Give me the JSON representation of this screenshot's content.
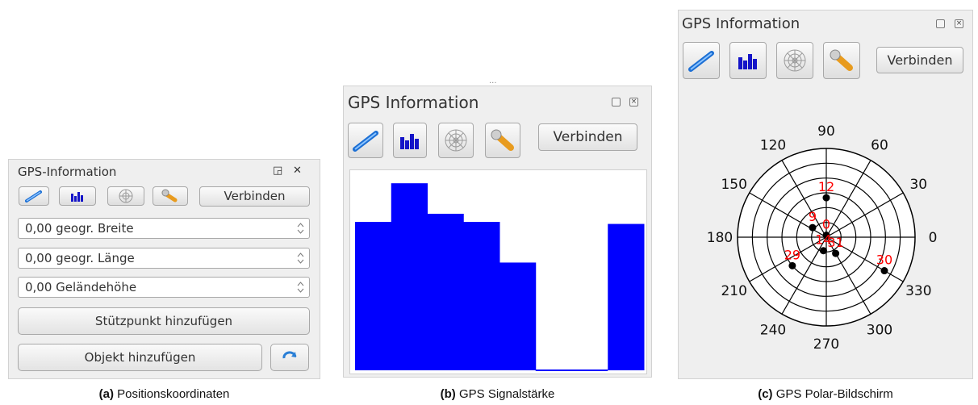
{
  "panel_a": {
    "title": "GPS-Information",
    "float_glyph": "◲",
    "close_glyph": "✕",
    "connect_label": "Verbinden",
    "fields": [
      {
        "value": "0,00 geogr. Breite"
      },
      {
        "value": "0,00 geogr. Länge"
      },
      {
        "value": "0,00 Geländehöhe"
      }
    ],
    "add_vertex_label": "Stützpunkt hinzufügen",
    "add_feature_label": "Objekt hinzufügen",
    "caption_letter": "(a)",
    "caption_text": "Positionskoordinaten"
  },
  "panel_b": {
    "title": "GPS Information",
    "connect_label": "Verbinden",
    "signal_color": "#0000ff",
    "signal_bars": [
      0.73,
      0.92,
      0.77,
      0.73,
      0.53,
      0.0,
      0.0,
      0.72
    ],
    "caption_letter": "(b)",
    "caption_text": "GPS Signalstärke"
  },
  "panel_c": {
    "title": "GPS Information",
    "connect_label": "Verbinden",
    "azimuth_labels": [
      "0",
      "30",
      "60",
      "90",
      "120",
      "150",
      "180",
      "210",
      "240",
      "270",
      "300",
      "330"
    ],
    "satellite_color": "#ff0000",
    "satellites": [
      {
        "id": "12",
        "azimuth": 90,
        "elevation": 50
      },
      {
        "id": "9",
        "azimuth": 145,
        "elevation": 73
      },
      {
        "id": "0",
        "azimuth": 90,
        "elevation": 88
      },
      {
        "id": "14",
        "azimuth": 258,
        "elevation": 76
      },
      {
        "id": "31",
        "azimuth": 300,
        "elevation": 71
      },
      {
        "id": "29",
        "azimuth": 220,
        "elevation": 45
      },
      {
        "id": "30",
        "azimuth": 330,
        "elevation": 22
      }
    ],
    "caption_letter": "(c)",
    "caption_text": "GPS Polar-Bildschirm"
  }
}
